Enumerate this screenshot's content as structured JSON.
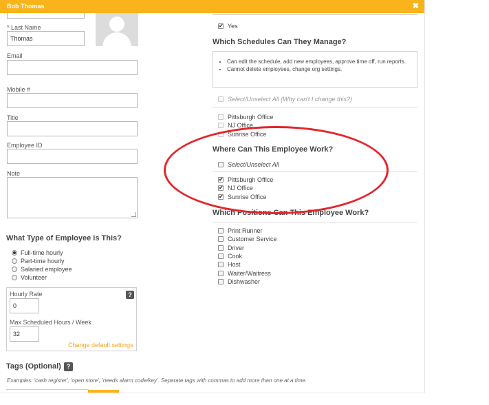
{
  "modal": {
    "title": "Bob Thomas",
    "close_glyph": "✖"
  },
  "profile": {
    "first_name_value": "",
    "last_name_label": "* Last Name",
    "last_name_value": "Thomas",
    "email_label": "Email",
    "email_value": "",
    "mobile_label": "Mobile #",
    "mobile_value": "",
    "title_label": "Title",
    "title_value": "",
    "employee_id_label": "Employee ID",
    "employee_id_value": "",
    "note_label": "Note"
  },
  "employee_type": {
    "heading": "What Type of Employee is This?",
    "options": [
      {
        "label": "Full-time hourly",
        "selected": true
      },
      {
        "label": "Part-time hourly",
        "selected": false
      },
      {
        "label": "Salaried employee",
        "selected": false
      },
      {
        "label": "Volunteer",
        "selected": false
      }
    ]
  },
  "rate": {
    "hourly_rate_label": "Hourly Rate",
    "hourly_rate_value": "0",
    "max_hours_label": "Max Scheduled Hours / Week",
    "max_hours_value": "32",
    "help_glyph": "?",
    "change_defaults_link": "Change default settings"
  },
  "tags": {
    "heading": "Tags (Optional)",
    "help_glyph": "?",
    "examples": "Examples: 'cash register', 'open store', 'needs alarm code/key'. Separate tags with commas to add more than one at a time."
  },
  "manager": {
    "yes_label": "Yes",
    "yes_checked": true
  },
  "schedules": {
    "heading": "Which Schedules Can They Manage?",
    "info_items": [
      "Can edit the schedule, add new employees, approve time off, run reports.",
      "Cannot delete employees, change org settings."
    ],
    "select_all_label": "Select/Unselect All (Why can't I change this?)",
    "locations": [
      "Pittsburgh Office",
      "NJ Office",
      "Sunrise Office"
    ]
  },
  "work_locations": {
    "heading": "Where Can This Employee Work?",
    "select_all_label": "Select/Unselect All",
    "locations": [
      {
        "label": "Pittsburgh Office",
        "checked": true
      },
      {
        "label": "NJ Office",
        "checked": true
      },
      {
        "label": "Sunrise Office",
        "checked": true
      }
    ]
  },
  "positions": {
    "heading": "Which Positions Can This Employee Work?",
    "items": [
      {
        "label": "Print Runner",
        "checked": false
      },
      {
        "label": "Customer Service",
        "checked": false
      },
      {
        "label": "Driver",
        "checked": false
      },
      {
        "label": "Cook",
        "checked": false
      },
      {
        "label": "Host",
        "checked": false
      },
      {
        "label": "Waiter/Waitress",
        "checked": false
      },
      {
        "label": "Dishwasher",
        "checked": false
      }
    ]
  },
  "colors": {
    "accent": "#f9b31b",
    "link": "#f5a51d",
    "annotation": "#e3262b"
  },
  "icons": {
    "close": "close-icon",
    "avatar": "user-placeholder-icon",
    "help": "question-icon",
    "check": "check-icon",
    "annotation": "red-ellipse-annotation"
  }
}
